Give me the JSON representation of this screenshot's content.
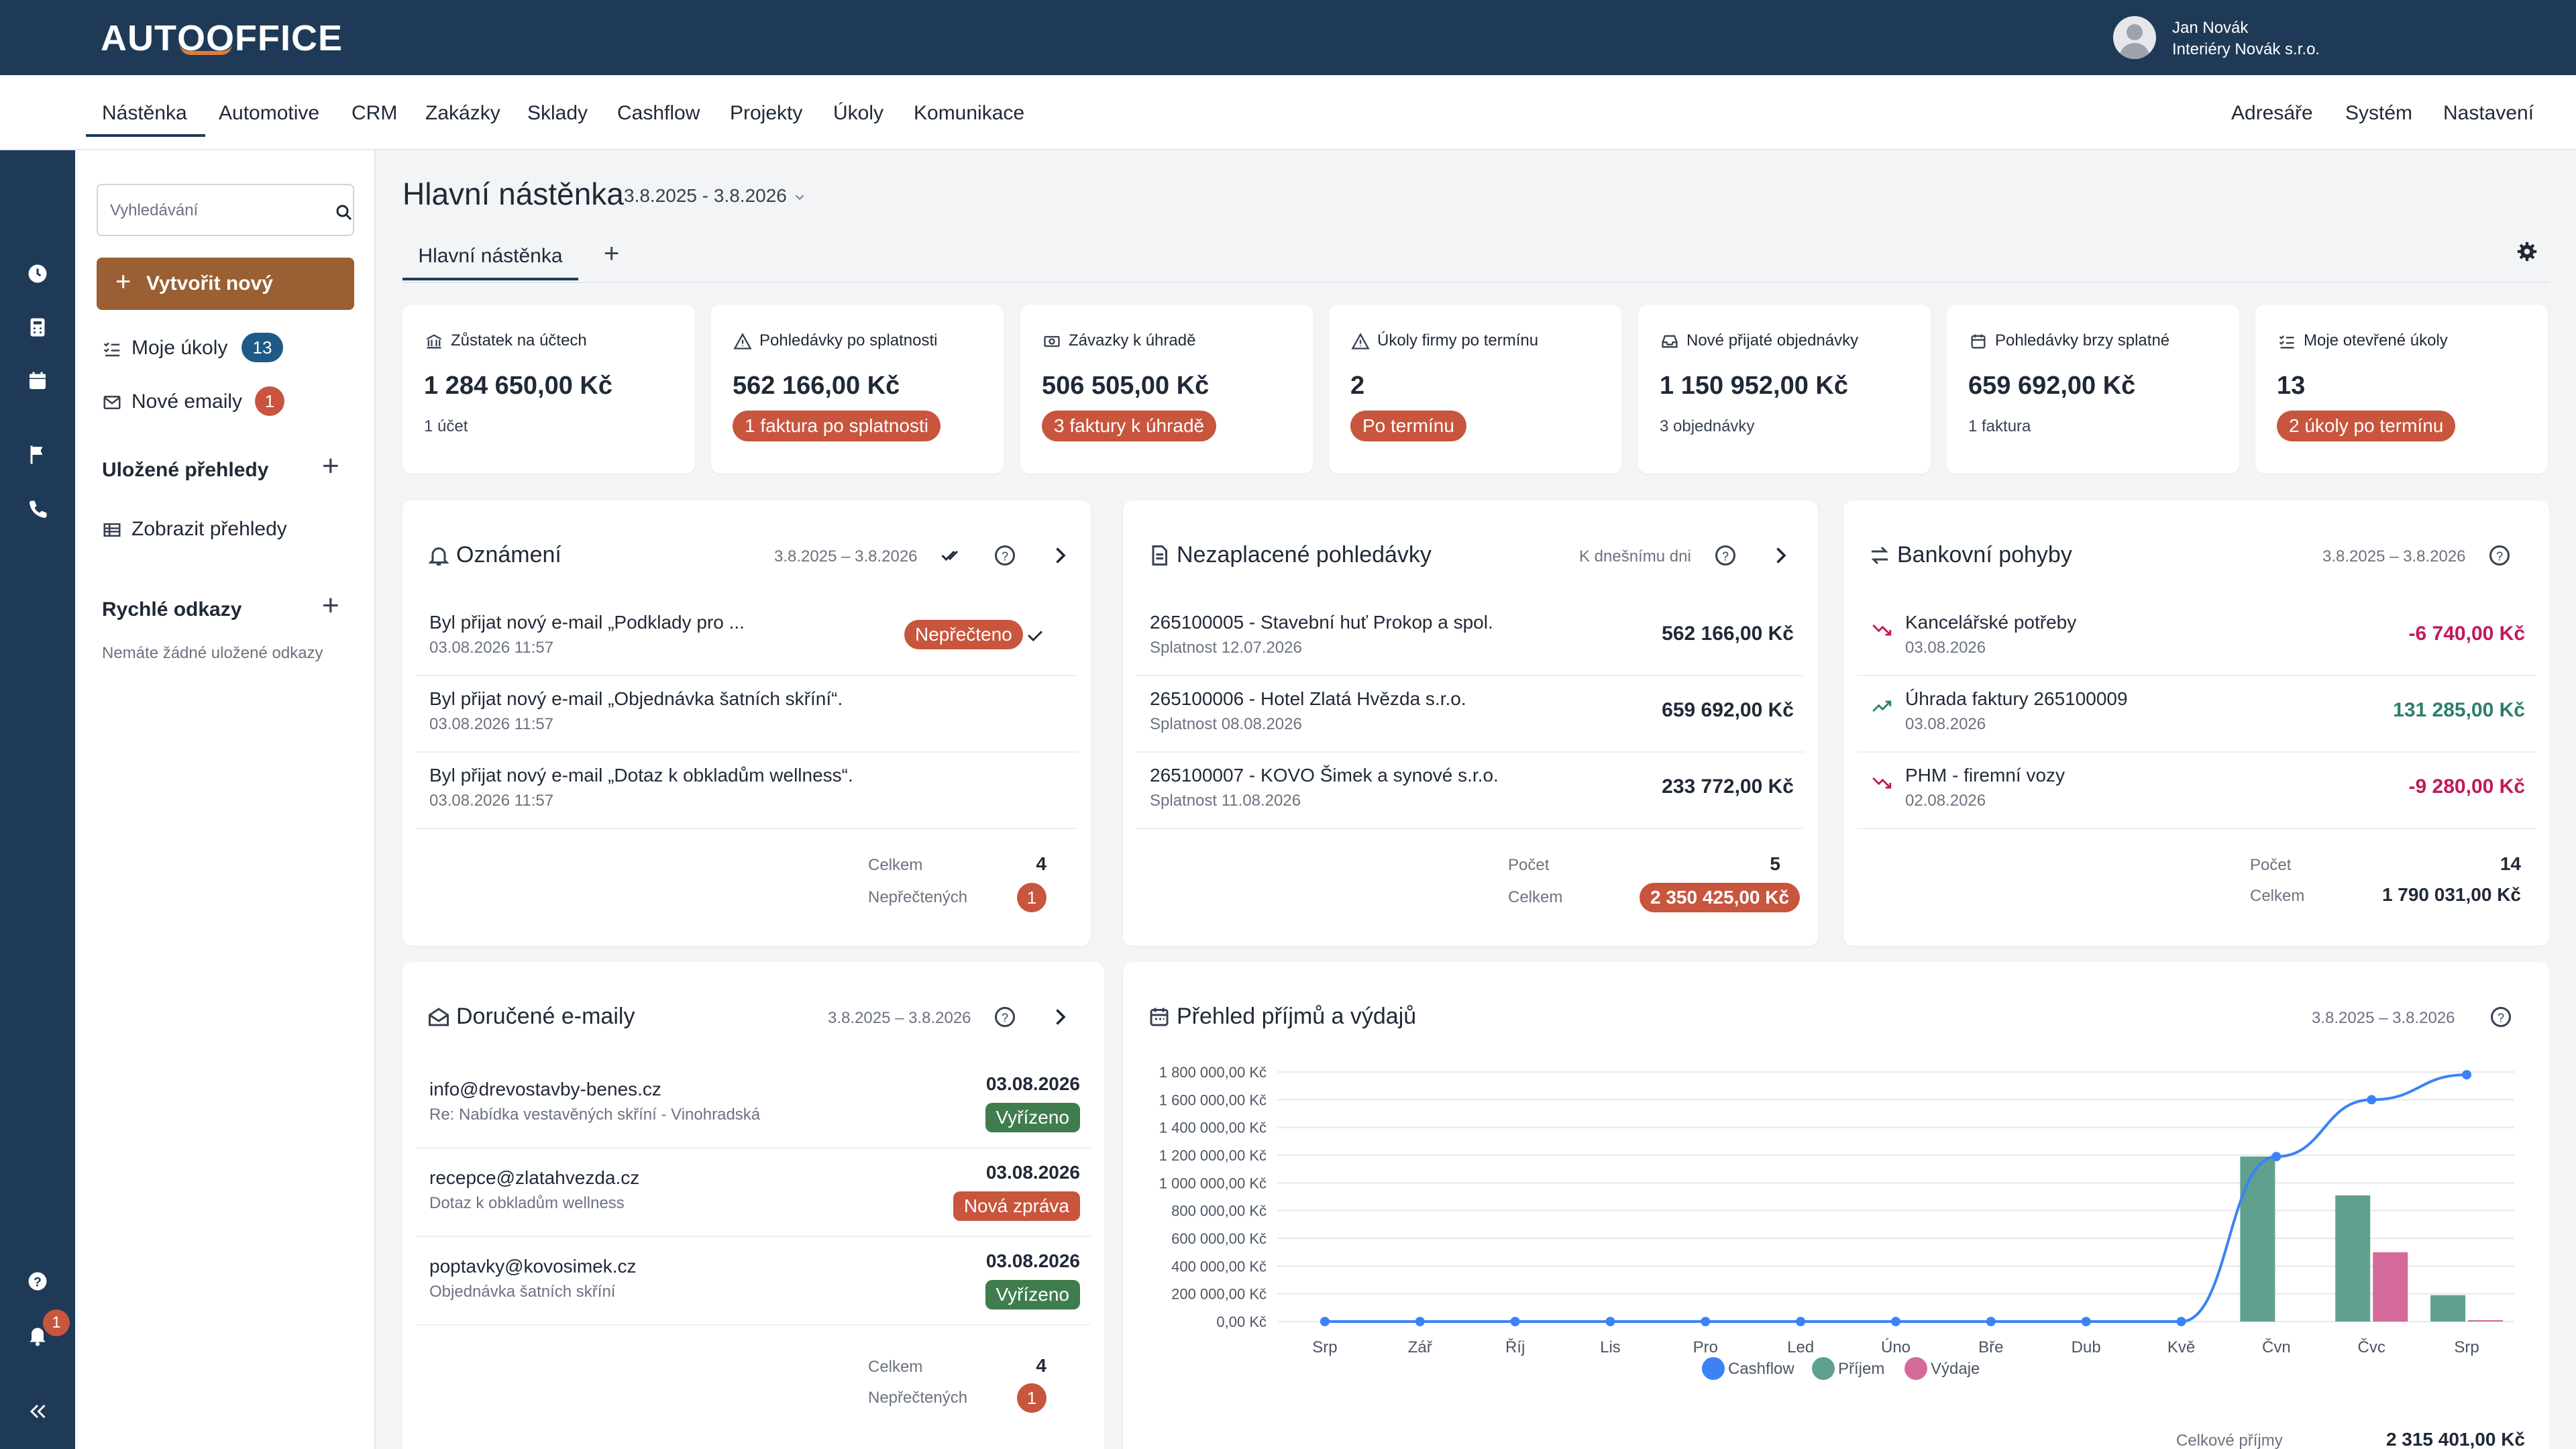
{
  "app": {
    "logo_text": "AUTOFFICE",
    "user_name": "Jan Novák",
    "user_company": "Interiéry Novák s.r.o."
  },
  "nav": {
    "items": [
      "Nástěnka",
      "Automotive",
      "CRM",
      "Zakázky",
      "Sklady",
      "Cashflow",
      "Projekty",
      "Úkoly",
      "Komunikace"
    ],
    "right_items": [
      "Adresáře",
      "Systém",
      "Nastavení"
    ],
    "active": "Nástěnka"
  },
  "rail": {
    "icons": [
      "clock-icon",
      "calculator-icon",
      "calendar-icon",
      "flag-icon",
      "phone-icon",
      "help-icon",
      "bell-icon",
      "collapse-icon"
    ],
    "bell_badge": "1"
  },
  "sidebar": {
    "search_placeholder": "Vyhledávání",
    "create_label": "Vytvořit nový",
    "my_tasks_label": "Moje úkoly",
    "my_tasks_count": "13",
    "new_emails_label": "Nové emaily",
    "new_emails_count": "1",
    "saved_views_heading": "Uložené přehledy",
    "show_views_label": "Zobrazit přehledy",
    "quick_links_heading": "Rychlé odkazy",
    "quick_links_empty": "Nemáte žádné uložené odkazy"
  },
  "page": {
    "title": "Hlavní nástěnka",
    "date_range": "3.8.2025 - 3.8.2026",
    "tab_label": "Hlavní nástěnka",
    "tab_add": "+"
  },
  "kpis": [
    {
      "title": "Zůstatek na účtech",
      "value": "1 284 650,00 Kč",
      "sub": "1 účet",
      "icon": "bank-icon"
    },
    {
      "title": "Pohledávky po splatnosti",
      "value": "562 166,00 Kč",
      "pill": "1 faktura po splatnosti",
      "icon": "warning-icon"
    },
    {
      "title": "Závazky k úhradě",
      "value": "506 505,00 Kč",
      "pill": "3 faktury k úhradě",
      "icon": "money-icon"
    },
    {
      "title": "Úkoly firmy po termínu",
      "value": "2",
      "pill": "Po termínu",
      "icon": "warning-icon"
    },
    {
      "title": "Nové přijaté objednávky",
      "value": "1 150 952,00 Kč",
      "sub": "3 objednávky",
      "icon": "inbox-icon"
    },
    {
      "title": "Pohledávky brzy splatné",
      "value": "659 692,00 Kč",
      "sub": "1 faktura",
      "icon": "calendar-icon"
    },
    {
      "title": "Moje otevřené úkoly",
      "value": "13",
      "pill": "2 úkoly po termínu",
      "icon": "checklist-icon"
    }
  ],
  "announcements": {
    "title": "Oznámení",
    "date": "3.8.2025 – 3.8.2026",
    "items": [
      {
        "text": "Byl přijat nový e-mail „Podklady pro ...",
        "time": "03.08.2026 11:57",
        "badge": "Nepřečteno"
      },
      {
        "text": "Byl přijat nový e-mail „Objednávka šatních skříní“.",
        "time": "03.08.2026 11:57"
      },
      {
        "text": "Byl přijat nový e-mail „Dotaz k obkladům wellness“.",
        "time": "03.08.2026 11:57"
      }
    ],
    "total_label": "Celkem",
    "total_value": "4",
    "unread_label": "Nepřečtených",
    "unread_value": "1"
  },
  "receivables": {
    "title": "Nezaplacené pohledávky",
    "filter": "K dnešnímu dni",
    "items": [
      {
        "name": "265100005 - Stavební huť Prokop a spol.",
        "due": "Splatnost 12.07.2026",
        "amount": "562 166,00 Kč"
      },
      {
        "name": "265100006 - Hotel Zlatá Hvězda s.r.o.",
        "due": "Splatnost 08.08.2026",
        "amount": "659 692,00 Kč"
      },
      {
        "name": "265100007 - KOVO Šimek a synové s.r.o.",
        "due": "Splatnost 11.08.2026",
        "amount": "233 772,00 Kč"
      }
    ],
    "count_label": "Počet",
    "count_value": "5",
    "total_label": "Celkem",
    "total_value": "2 350 425,00 Kč"
  },
  "bank": {
    "title": "Bankovní pohyby",
    "date": "3.8.2025 – 3.8.2026",
    "items": [
      {
        "name": "Kancelářské potřeby",
        "date": "03.08.2026",
        "amount": "-6 740,00 Kč",
        "dir": "down"
      },
      {
        "name": "Úhrada faktury 265100009",
        "date": "03.08.2026",
        "amount": "131 285,00 Kč",
        "dir": "up"
      },
      {
        "name": "PHM - firemní vozy",
        "date": "02.08.2026",
        "amount": "-9 280,00 Kč",
        "dir": "down"
      }
    ],
    "count_label": "Počet",
    "count_value": "14",
    "total_label": "Celkem",
    "total_value": "1 790 031,00 Kč"
  },
  "emails": {
    "title": "Doručené e-maily",
    "date": "3.8.2025 – 3.8.2026",
    "items": [
      {
        "from": "info@drevostavby-benes.cz",
        "subject": "Re: Nabídka vestavěných skříní - Vinohradská",
        "date": "03.08.2026",
        "status": "Vyřízeno",
        "status_type": "green"
      },
      {
        "from": "recepce@zlatahvezda.cz",
        "subject": "Dotaz k obkladům wellness",
        "date": "03.08.2026",
        "status": "Nová zpráva",
        "status_type": "red"
      },
      {
        "from": "poptavky@kovosimek.cz",
        "subject": "Objednávka šatních skříní",
        "date": "03.08.2026",
        "status": "Vyřízeno",
        "status_type": "green"
      }
    ],
    "total_label": "Celkem",
    "total_value": "4",
    "unread_label": "Nepřečtených",
    "unread_value": "1"
  },
  "overview": {
    "title": "Přehled příjmů a výdajů",
    "date": "3.8.2025 – 3.8.2026",
    "footer_label": "Celkové příjmy",
    "footer_value": "2 315 401,00 Kč"
  },
  "colors": {
    "header": "#1e3a56",
    "accent_brown": "#9a5f33",
    "badge_red": "#c8553d",
    "badge_green": "#3f7d4f",
    "cashflow": "#3b82f6",
    "income": "#5fa08e",
    "expense": "#d46a9a"
  },
  "chart_data": {
    "type": "bar",
    "title": "",
    "categories": [
      "Srp",
      "Zář",
      "Říj",
      "Lis",
      "Pro",
      "Led",
      "Úno",
      "Bře",
      "Dub",
      "Kvě",
      "Čvn",
      "Čvc",
      "Srp"
    ],
    "y_ticks": [
      "0,00 Kč",
      "200 000,00 Kč",
      "400 000,00 Kč",
      "600 000,00 Kč",
      "800 000,00 Kč",
      "1 000 000,00 Kč",
      "1 200 000,00 Kč",
      "1 400 000,00 Kč",
      "1 600 000,00 Kč",
      "1 800 000,00 Kč"
    ],
    "ylim": [
      0,
      1800000
    ],
    "grid": true,
    "legend_position": "bottom",
    "series": [
      {
        "name": "Cashflow",
        "type": "line",
        "color": "#3b82f6",
        "values": [
          0,
          0,
          0,
          0,
          0,
          0,
          0,
          0,
          0,
          0,
          1190000,
          1600000,
          1780000
        ]
      },
      {
        "name": "Příjem",
        "type": "bar",
        "color": "#5fa08e",
        "values": [
          0,
          0,
          0,
          0,
          0,
          0,
          0,
          0,
          0,
          0,
          1190000,
          910000,
          190000
        ]
      },
      {
        "name": "Výdaje",
        "type": "bar",
        "color": "#d46a9a",
        "values": [
          0,
          0,
          0,
          0,
          0,
          0,
          0,
          0,
          0,
          0,
          0,
          500000,
          10000
        ]
      }
    ]
  }
}
